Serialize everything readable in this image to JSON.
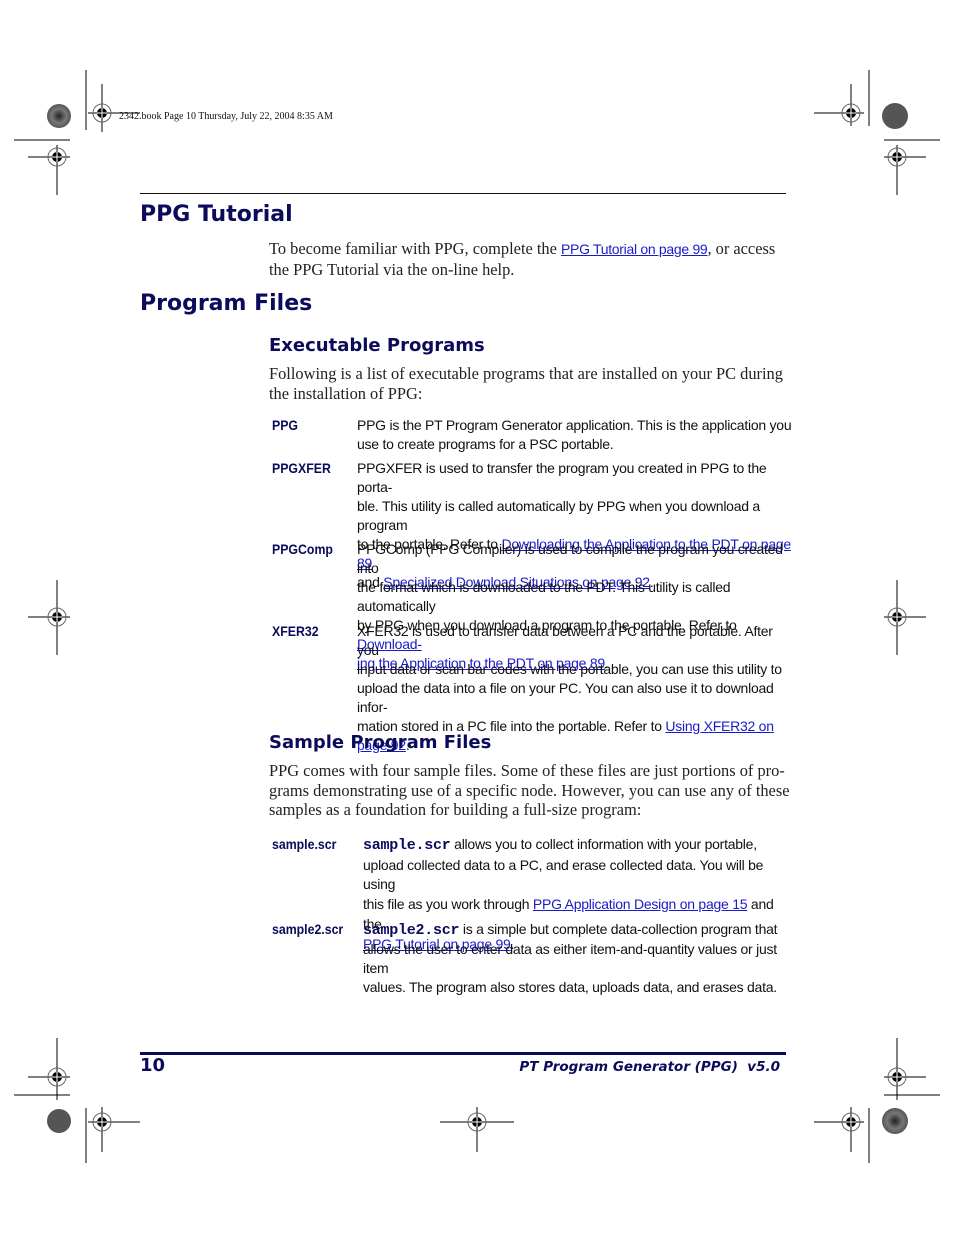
{
  "book_header": "2342.book  Page 10  Thursday, July 22, 2004  8:35 AM",
  "sections": {
    "ppg_tutorial": {
      "title": "PPG Tutorial",
      "text_before": "To become familiar with PPG, complete the ",
      "link": "PPG Tutorial on page 99",
      "text_line1_after": ", or access",
      "text_line2": "the PPG Tutorial via the on-line help."
    },
    "program_files": {
      "title": "Program Files"
    },
    "executable_programs": {
      "title": "Executable Programs",
      "intro_line1": "Following is a list of executable programs that are installed on your PC during",
      "intro_line2": "the installation of PPG:",
      "items": [
        {
          "term": "PPG",
          "lines": [
            "PPG is the PT Program Generator application. This is the application you",
            "use to create programs for a PSC portable."
          ]
        },
        {
          "term": "PPGXFER",
          "line1": "PPGXFER is used to transfer the program you created in PPG to the porta-",
          "line2": "ble. This utility is called automatically by PPG when you download a program",
          "line3_before": "to the portable. Refer to ",
          "line3_link": "Downloading the Application to the PDT on page 89",
          "line4_before": "and ",
          "line4_link": "Specialized Download Situations on page 92",
          "line4_after": "."
        },
        {
          "term": "PPGComp",
          "line1": "PPGComp (PPG Compiler) is used to compile the program you created into",
          "line2": "the format which is downloaded to the PDT. This utility is called automatically",
          "line3_before": "by PPG when you download a program to the portable. Refer to ",
          "line3_link": "Download-",
          "line4_link": "ing the Application to the PDT on page 89",
          "line4_after": "."
        },
        {
          "term": "XFER32",
          "line1": "XFER32 is used to transfer data between a PC and the portable. After you",
          "line2": "input data or scan bar codes with the portable, you can use this utility to",
          "line3": "upload the data into a file on your PC. You can also use it to download infor-",
          "line4_before": "mation stored in a PC file into the portable. Refer to ",
          "line4_link": "Using XFER32 on ",
          "line5_link": "page 92",
          "line5_after": "."
        }
      ]
    },
    "sample_program_files": {
      "title": "Sample Program Files",
      "intro_lines": [
        "PPG comes with four sample files. Some of these files are just portions of pro-",
        "grams demonstrating use of a specific node. However, you can use any of these",
        "samples as a foundation for building a full-size program:"
      ],
      "items": [
        {
          "term": "sample.scr",
          "code": "sample.scr",
          "line1_after": " allows you to collect information with your portable,",
          "line2": "upload collected data to a PC, and erase collected data. You will be using",
          "line3_before": "this file as you work through ",
          "line3_link": "PPG Application Design on page 15",
          "line3_after": " and the",
          "line4_link": "PPG Tutorial on page 99",
          "line4_after": "."
        },
        {
          "term": "sample2.scr",
          "code": "sample2.scr",
          "line1_after": " is a simple but complete data-collection program that",
          "line2": "allows the user to enter data as either item-and-quantity values or just item",
          "line3": "values. The program also stores data, uploads data, and erases data."
        }
      ]
    }
  },
  "footer": {
    "page_number": "10",
    "product": "PT Program Generator (PPG)  v5.0"
  },
  "colors": {
    "heading": "#0b0b5c",
    "link": "#1a1ac8"
  }
}
